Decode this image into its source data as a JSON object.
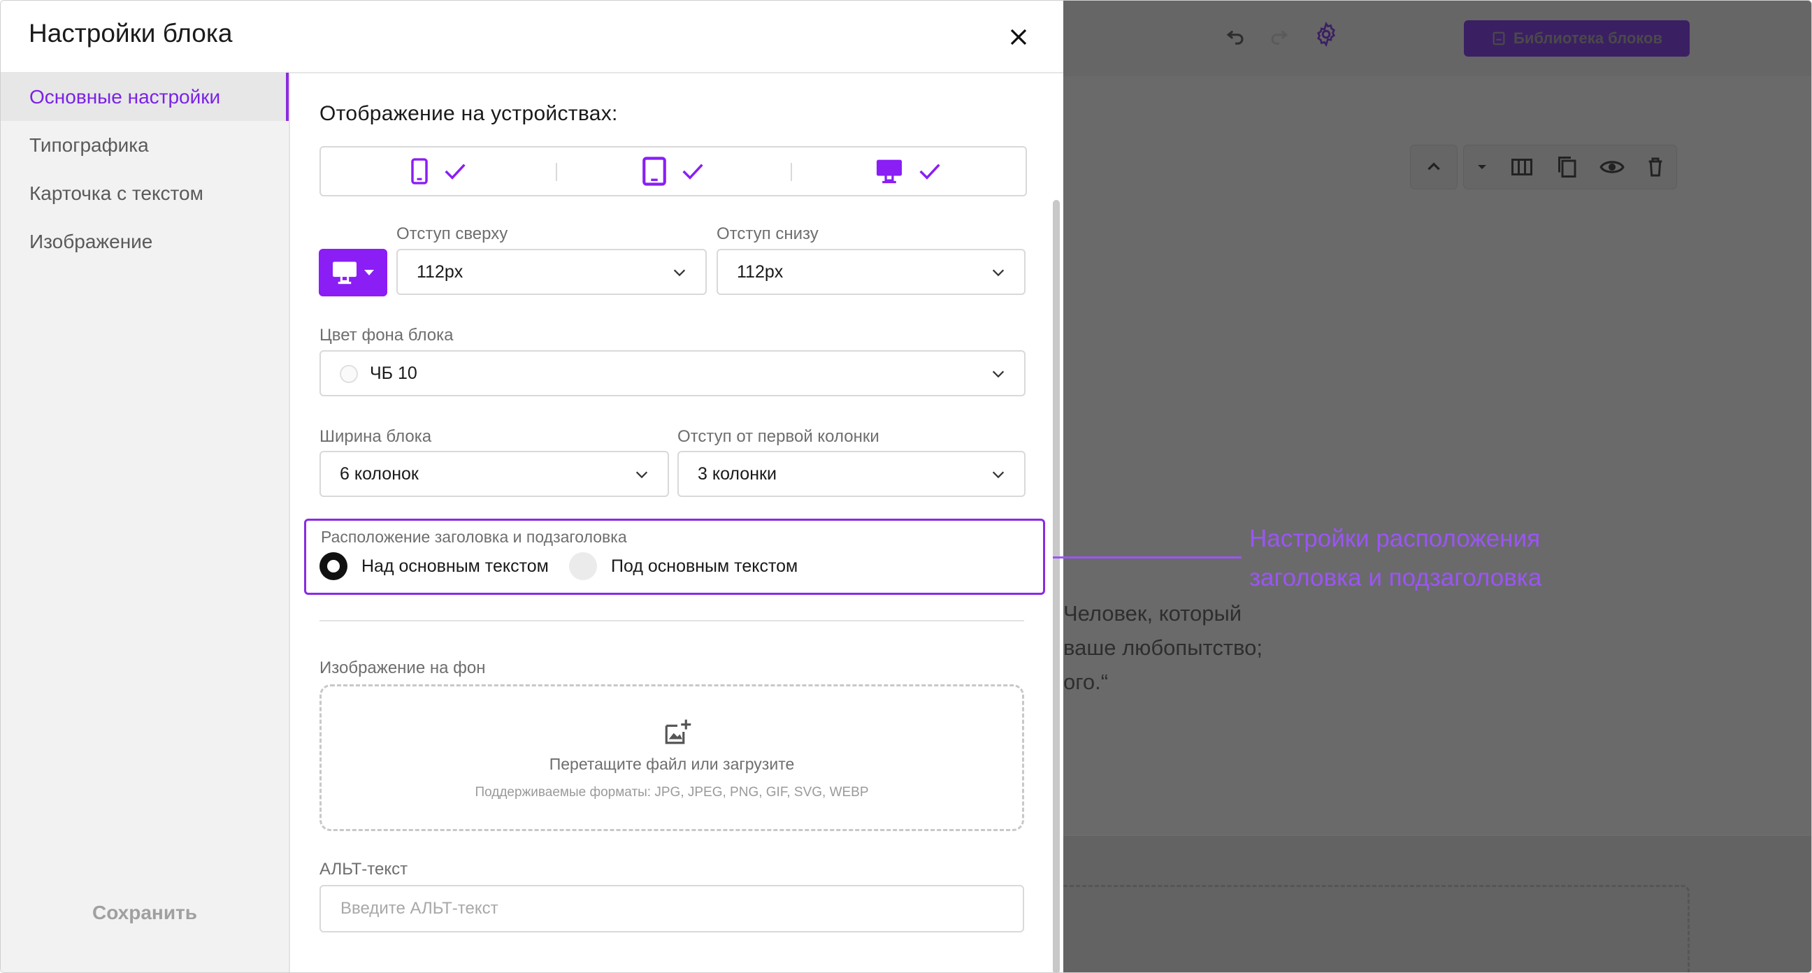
{
  "modal": {
    "title": "Настройки блока",
    "nav": [
      {
        "label": "Основные настройки",
        "active": true
      },
      {
        "label": "Типографика",
        "active": false
      },
      {
        "label": "Карточка с текстом",
        "active": false
      },
      {
        "label": "Изображение",
        "active": false
      }
    ],
    "save_label": "Сохранить"
  },
  "display": {
    "title": "Отображение на устройствах:",
    "devices": [
      {
        "icon": "mobile-icon",
        "checked": true
      },
      {
        "icon": "tablet-icon",
        "checked": true
      },
      {
        "icon": "desktop-icon",
        "checked": true
      }
    ]
  },
  "padding": {
    "device_icon": "desktop-icon",
    "top_label": "Отступ сверху",
    "top_value": "112px",
    "bottom_label": "Отступ снизу",
    "bottom_value": "112px"
  },
  "bg_color": {
    "label": "Цвет фона блока",
    "value": "ЧБ 10"
  },
  "width": {
    "label": "Ширина блока",
    "value": "6 колонок"
  },
  "offset": {
    "label": "Отступ от первой колонки",
    "value": "3 колонки"
  },
  "heading_position": {
    "label": "Расположение заголовка и подзаголовка",
    "options": [
      {
        "label": "Над основным текстом",
        "selected": true
      },
      {
        "label": "Под основным текстом",
        "selected": false
      }
    ]
  },
  "bg_image": {
    "label": "Изображение на фон",
    "drop_text": "Перетащите файл или загрузите",
    "formats": "Поддерживаемые форматы: JPG, JPEG, PNG, GIF, SVG, WEBP"
  },
  "alt_text": {
    "label": "АЛЬТ-текст",
    "placeholder": "Введите АЛЬТ-текст",
    "value": ""
  },
  "background_editor": {
    "library_button": "Библиотека блоков",
    "quote_lines": [
      "Человек, который",
      "ваше любопытство;",
      "ого.“"
    ]
  },
  "annotation": {
    "lines": [
      "Настройки расположения",
      "заголовка и подзаголовка"
    ]
  },
  "colors": {
    "accent": "#8a1ef5",
    "annotation": "#9b55f5",
    "overlay": "#6c6c6c"
  }
}
